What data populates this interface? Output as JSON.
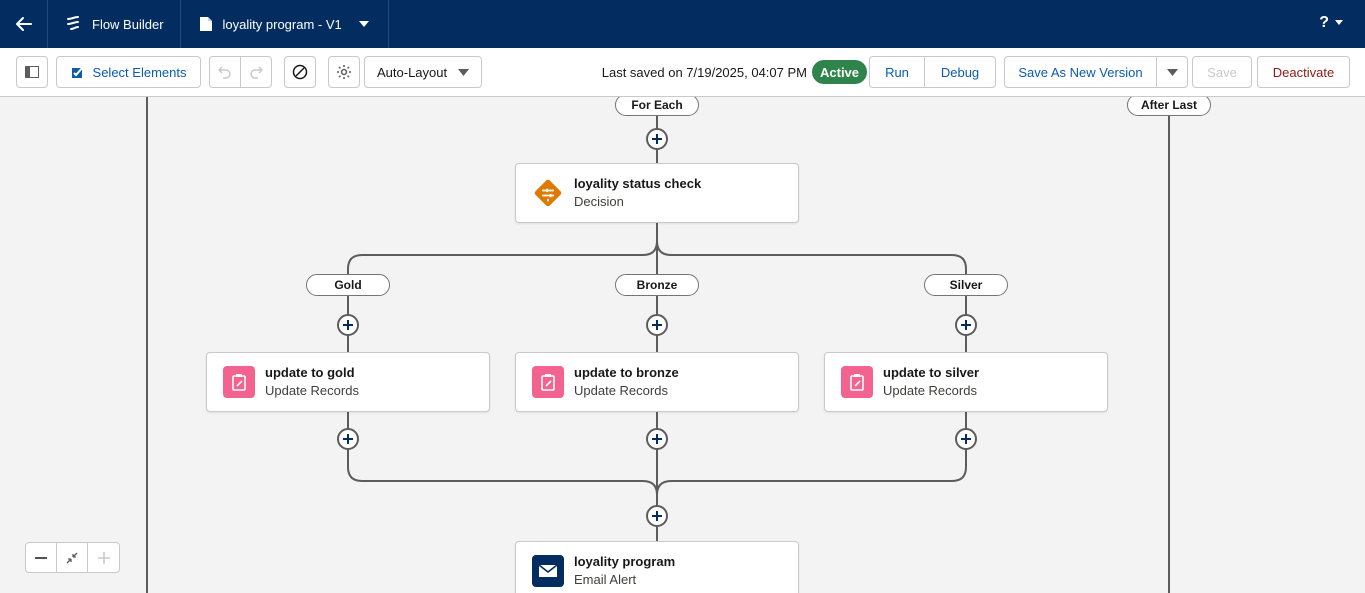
{
  "header": {
    "app_name": "Flow Builder",
    "file_name": "loyality program - V1",
    "help_label": "?"
  },
  "toolbar": {
    "select_elements_label": "Select Elements",
    "layout_label": "Auto-Layout",
    "last_saved": "Last saved on 7/19/2025, 04:07 PM",
    "status_badge": "Active",
    "run_label": "Run",
    "debug_label": "Debug",
    "save_as_new_version_label": "Save As New Version",
    "save_label": "Save",
    "deactivate_label": "Deactivate"
  },
  "canvas": {
    "for_each_label": "For Each",
    "after_last_label": "After Last",
    "decision": {
      "title": "loyality status check",
      "type": "Decision"
    },
    "outcomes": [
      "Gold",
      "Bronze",
      "Silver"
    ],
    "updates": [
      {
        "title": "update to gold",
        "type": "Update Records"
      },
      {
        "title": "update to bronze",
        "type": "Update Records"
      },
      {
        "title": "update to silver",
        "type": "Update Records"
      }
    ],
    "email": {
      "title": "loyality program",
      "type": "Email Alert"
    }
  },
  "colors": {
    "header_bg": "#032d60",
    "brand_link": "#0b5cab",
    "active_badge": "#2e844a",
    "decision_icon": "#dd7a01",
    "update_icon": "#f4628f",
    "email_icon": "#032d60",
    "deactivate_text": "#8c1b15"
  },
  "icons": {
    "back": "arrow-left-icon",
    "app": "flow-icon",
    "file": "file-icon",
    "decision": "decision-icon",
    "update": "update-records-icon",
    "email": "email-icon"
  }
}
